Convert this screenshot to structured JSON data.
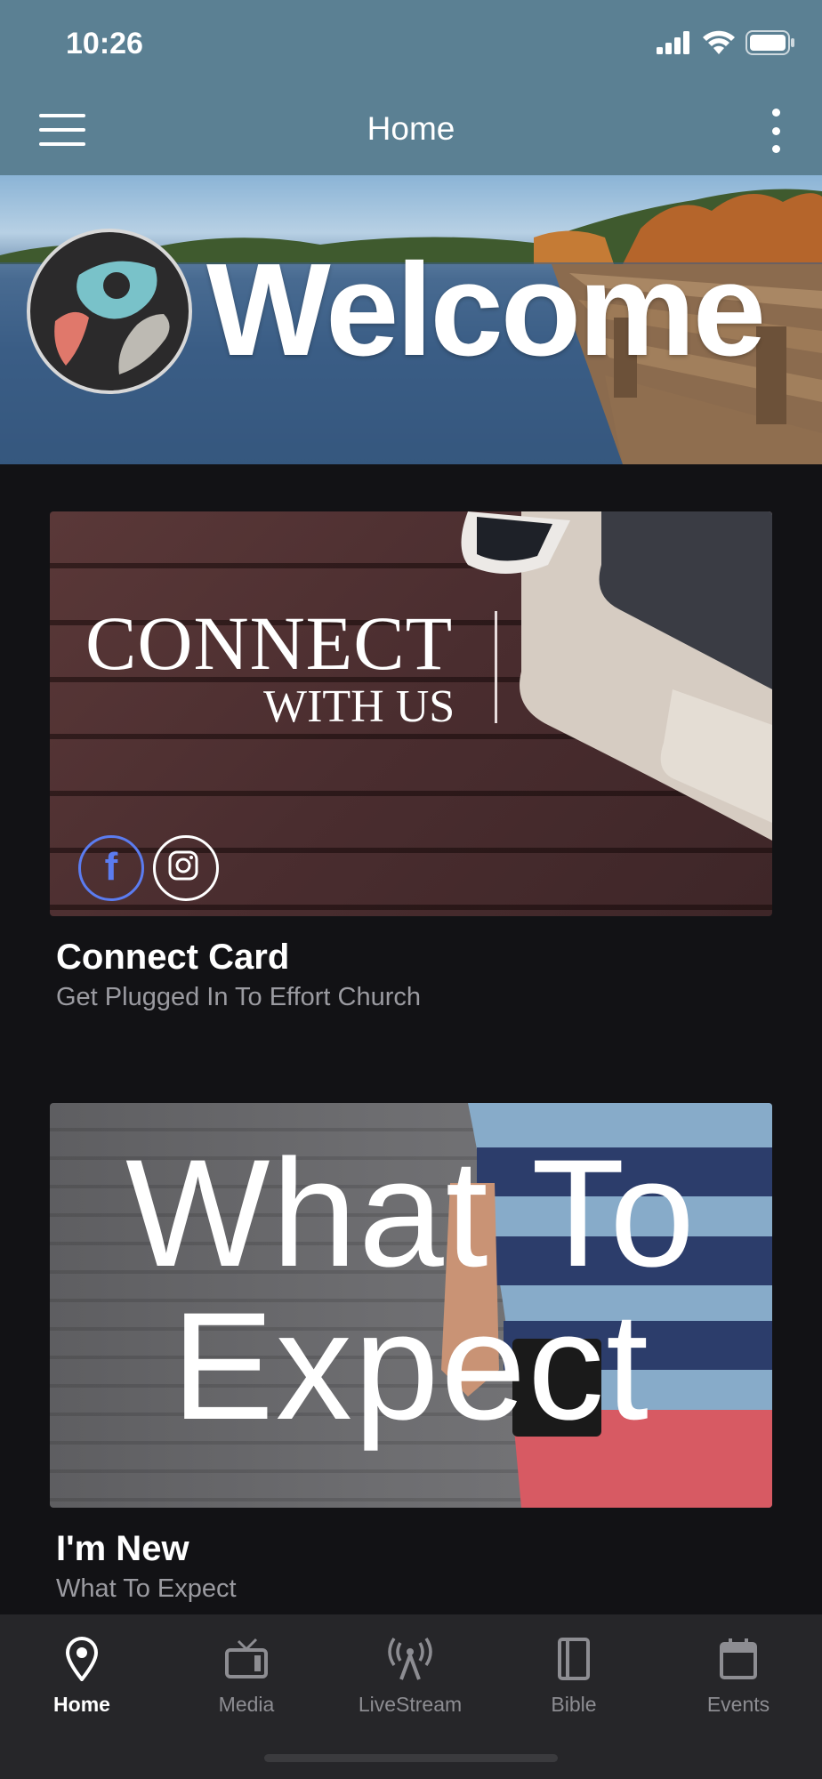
{
  "status_bar": {
    "time": "10:26"
  },
  "header": {
    "title": "Home",
    "menu_icon": "hamburger-icon",
    "more_icon": "kebab-icon"
  },
  "banner": {
    "welcome_text": "Welcome"
  },
  "cards": [
    {
      "image_text_line1": "CONNECT",
      "image_text_line2": "WITH US",
      "title": "Connect Card",
      "subtitle": "Get Plugged In To Effort Church",
      "social_icons": [
        "facebook-icon",
        "instagram-icon"
      ],
      "facebook_glyph": "f"
    },
    {
      "image_text_line1": "What To",
      "image_text_line2": "Expect",
      "title": "I'm New",
      "subtitle": "What To Expect"
    }
  ],
  "tabbar": {
    "items": [
      {
        "label": "Home",
        "icon": "map-pin-icon",
        "active": true
      },
      {
        "label": "Media",
        "icon": "tv-icon",
        "active": false
      },
      {
        "label": "LiveStream",
        "icon": "antenna-icon",
        "active": false
      },
      {
        "label": "Bible",
        "icon": "book-icon",
        "active": false
      },
      {
        "label": "Events",
        "icon": "calendar-icon",
        "active": false
      }
    ]
  },
  "colors": {
    "header_bg": "#5b8093",
    "page_bg": "#121215",
    "tabbar_bg": "#262629",
    "facebook": "#5b7cf0"
  }
}
